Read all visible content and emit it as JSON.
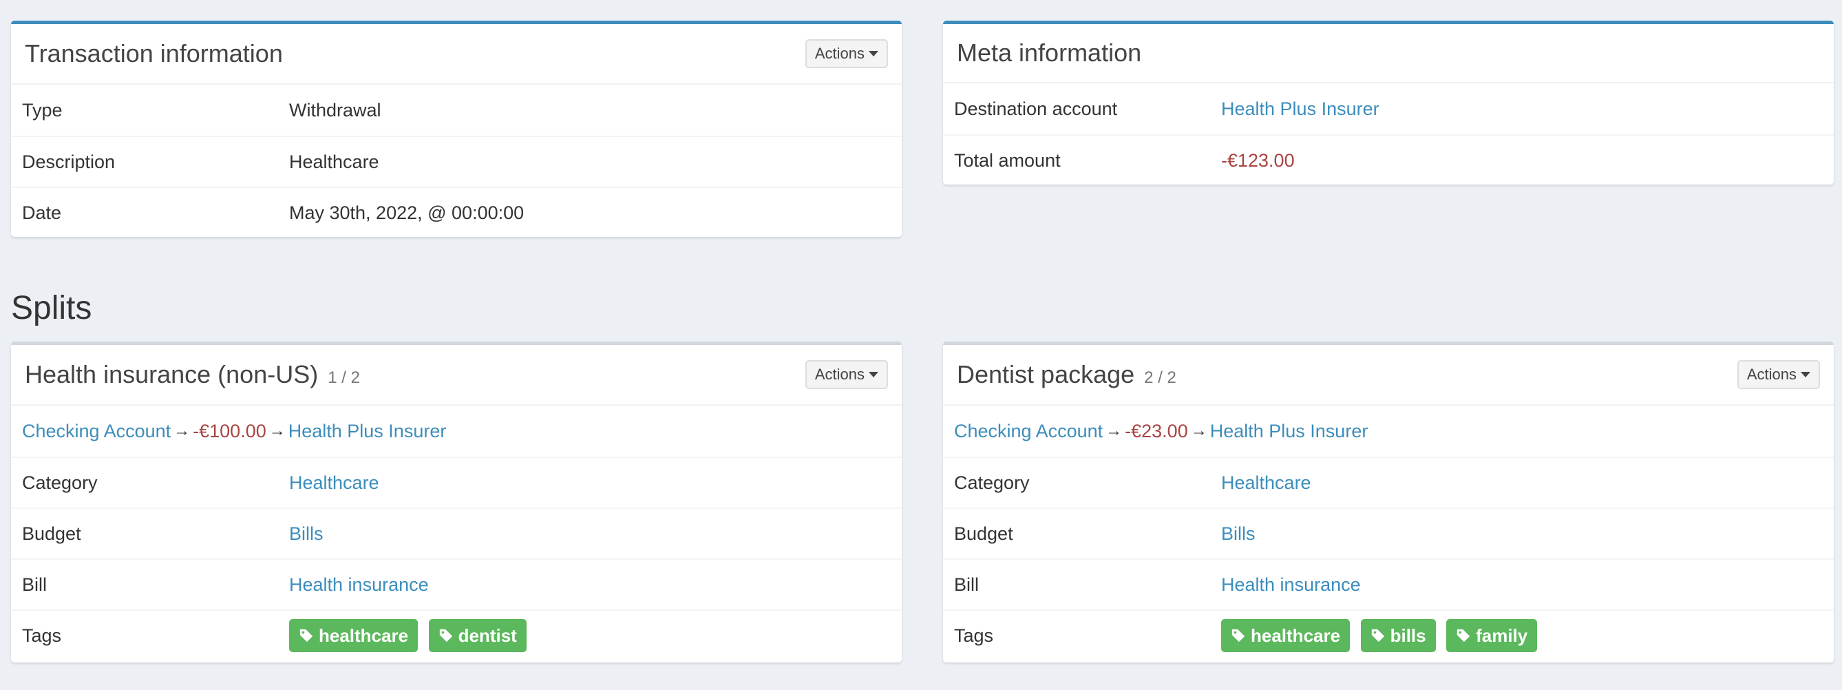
{
  "transaction_info": {
    "title": "Transaction information",
    "actions_label": "Actions",
    "rows": [
      {
        "label": "Type",
        "value": "Withdrawal"
      },
      {
        "label": "Description",
        "value": "Healthcare"
      },
      {
        "label": "Date",
        "value": "May 30th, 2022, @ 00:00:00"
      }
    ]
  },
  "meta_info": {
    "title": "Meta information",
    "rows": [
      {
        "label": "Destination account",
        "value": "Health Plus Insurer"
      },
      {
        "label": "Total amount",
        "value": "-€123.00"
      }
    ]
  },
  "splits_heading": "Splits",
  "splits": [
    {
      "title": "Health insurance (non-US)",
      "counter": "1 / 2",
      "actions_label": "Actions",
      "source": "Checking Account",
      "amount": "-€100.00",
      "destination": "Health Plus Insurer",
      "category_label": "Category",
      "category": "Healthcare",
      "budget_label": "Budget",
      "budget": "Bills",
      "bill_label": "Bill",
      "bill": "Health insurance",
      "tags_label": "Tags",
      "tags": [
        "healthcare",
        "dentist"
      ]
    },
    {
      "title": "Dentist package",
      "counter": "2 / 2",
      "actions_label": "Actions",
      "source": "Checking Account",
      "amount": "-€23.00",
      "destination": "Health Plus Insurer",
      "category_label": "Category",
      "category": "Healthcare",
      "budget_label": "Budget",
      "budget": "Bills",
      "bill_label": "Bill",
      "bill": "Health insurance",
      "tags_label": "Tags",
      "tags": [
        "healthcare",
        "bills",
        "family"
      ]
    }
  ],
  "arrow_symbol": "→",
  "colors": {
    "primary_border": "#3c8dbc",
    "neutral_border": "#d2d6de",
    "link": "#3c8dbc",
    "negative_amount": "#a94442",
    "tag_bg": "#5cb85c",
    "page_bg": "#ecf0f5"
  },
  "icons": {
    "tag": "tag-icon",
    "actions_caret": "caret-down-icon",
    "arrow": "arrow-right-icon"
  }
}
